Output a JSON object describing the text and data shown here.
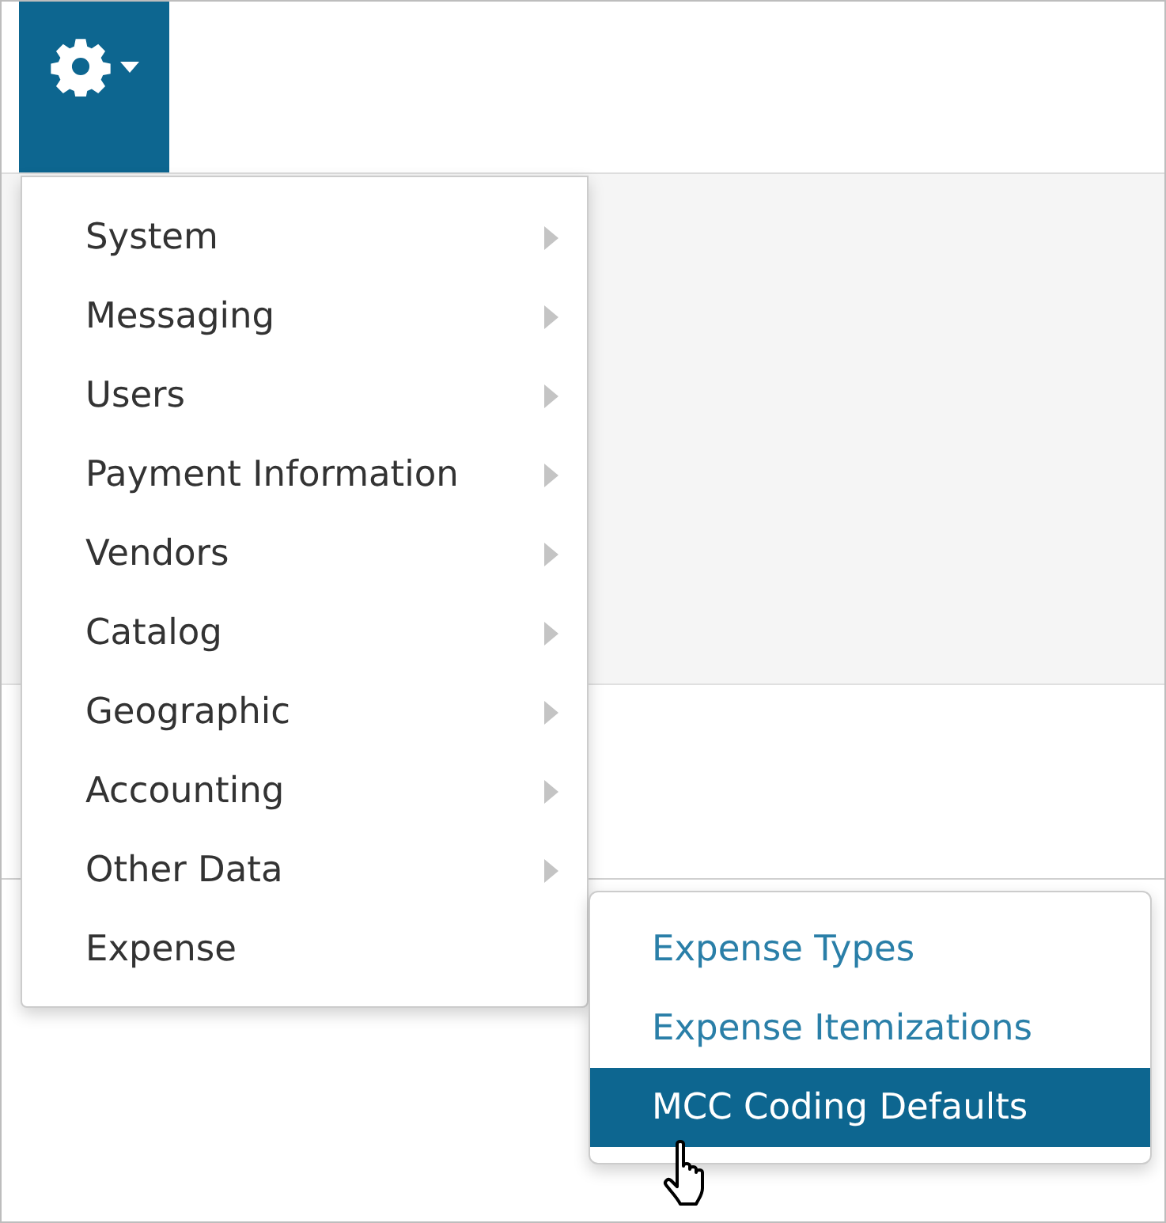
{
  "settings_button": {
    "expanded": true
  },
  "menu": {
    "items": [
      {
        "label": "System",
        "submenu_arrow": true
      },
      {
        "label": "Messaging",
        "submenu_arrow": true
      },
      {
        "label": "Users",
        "submenu_arrow": true
      },
      {
        "label": "Payment Information",
        "submenu_arrow": true
      },
      {
        "label": "Vendors",
        "submenu_arrow": true
      },
      {
        "label": "Catalog",
        "submenu_arrow": true
      },
      {
        "label": "Geographic",
        "submenu_arrow": true
      },
      {
        "label": "Accounting",
        "submenu_arrow": true
      },
      {
        "label": "Other Data",
        "submenu_arrow": true
      },
      {
        "label": "Expense",
        "submenu_arrow": false
      }
    ]
  },
  "submenu": {
    "items": [
      {
        "label": "Expense Types",
        "selected": false
      },
      {
        "label": "Expense Itemizations",
        "selected": false
      },
      {
        "label": "MCC Coding Defaults",
        "selected": true
      }
    ]
  }
}
